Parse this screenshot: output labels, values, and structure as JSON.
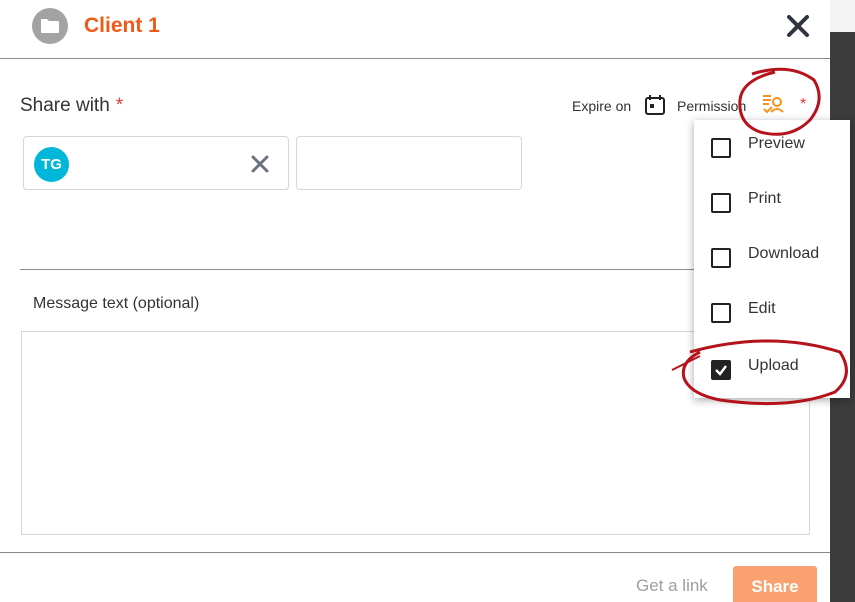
{
  "dialog": {
    "title": "Client 1",
    "icon": "folder-icon"
  },
  "share": {
    "label": "Share with",
    "required_mark": "*",
    "expire_label": "Expire on",
    "permission_label": "Permission",
    "permission_required_mark": "*"
  },
  "recipients": [
    {
      "initials": "TG",
      "color": "#00b7d9"
    }
  ],
  "recipient_input": {
    "value": "",
    "placeholder": ""
  },
  "message": {
    "label": "Message text (optional)",
    "value": "",
    "placeholder": ""
  },
  "permissions": [
    {
      "label": "Preview",
      "checked": false
    },
    {
      "label": "Print",
      "checked": false
    },
    {
      "label": "Download",
      "checked": false
    },
    {
      "label": "Edit",
      "checked": false
    },
    {
      "label": "Upload",
      "checked": true
    }
  ],
  "footer": {
    "get_link_label": "Get a link",
    "share_label": "Share"
  },
  "colors": {
    "title": "#f15a16",
    "required": "#e53935",
    "share_button": "#f9a26f",
    "permission_icon": "#f7931e",
    "annotation": "#b5121b"
  }
}
